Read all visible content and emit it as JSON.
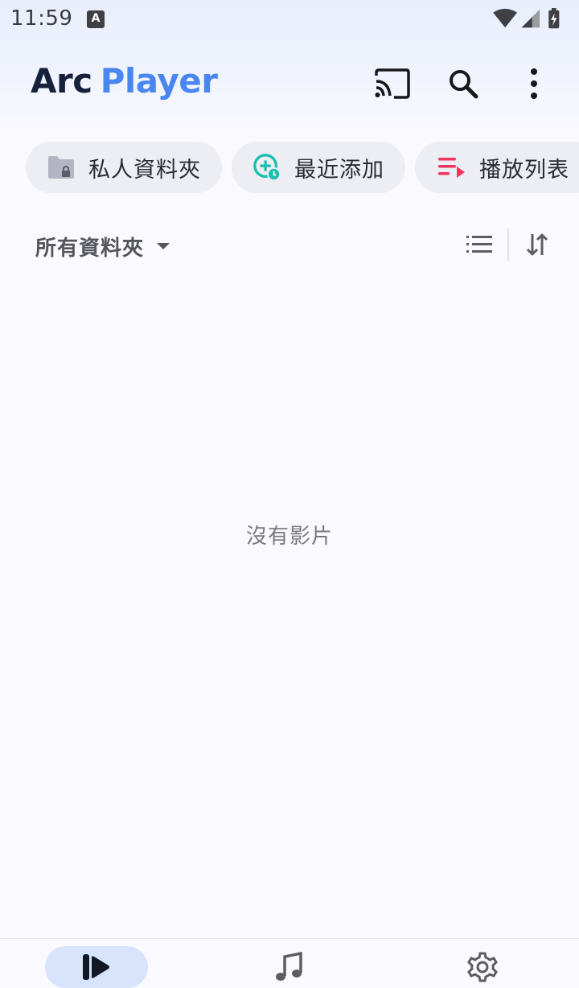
{
  "status_bar": {
    "time": "11:59",
    "notification_letter": "A"
  },
  "app_bar": {
    "logo_part1": "Arc",
    "logo_part2": "Player",
    "icons": [
      "cast-icon",
      "search-icon",
      "more-vert-icon"
    ]
  },
  "chips": [
    {
      "label": "私人資料夾",
      "icon": "locked-folder-icon"
    },
    {
      "label": "最近添加",
      "icon": "recent-add-icon"
    },
    {
      "label": "播放列表",
      "icon": "playlist-icon"
    }
  ],
  "folder_row": {
    "selector_label": "所有資料夾",
    "icons": [
      "dropdown-arrow-icon",
      "list-view-icon",
      "sort-icon"
    ]
  },
  "empty_state": {
    "message": "沒有影片"
  },
  "bottom_nav": {
    "items": [
      {
        "icon": "video-play-icon",
        "active": true
      },
      {
        "icon": "music-note-icon",
        "active": false
      },
      {
        "icon": "settings-gear-icon",
        "active": false
      }
    ]
  },
  "colors": {
    "brand_dark": "#17213b",
    "brand_blue": "#4a86f0",
    "teal_accent": "#1abfae",
    "pink_accent": "#f0365f",
    "active_nav_bg": "#d7e4fb"
  }
}
